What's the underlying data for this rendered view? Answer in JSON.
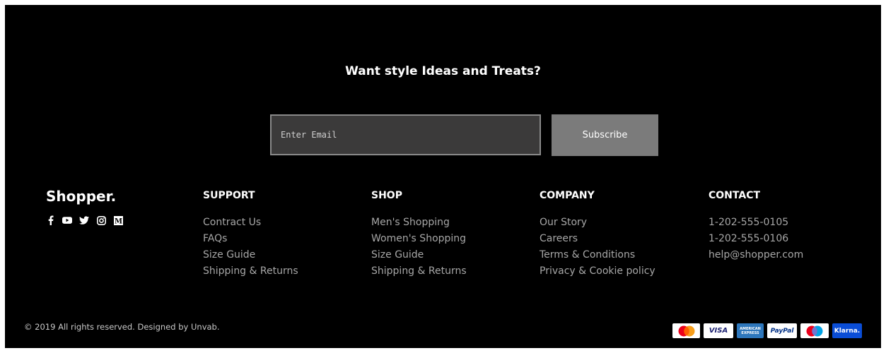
{
  "newsletter": {
    "title": "Want style Ideas and Treats?",
    "email_placeholder": "Enter Email",
    "subscribe_label": "Subscribe"
  },
  "brand": {
    "name": "Shopper.",
    "social_icons": [
      "facebook-icon",
      "youtube-icon",
      "twitter-icon",
      "instagram-icon",
      "medium-icon"
    ]
  },
  "columns": {
    "support": {
      "title": "SUPPORT",
      "links": [
        "Contract Us",
        "FAQs",
        "Size Guide",
        "Shipping & Returns"
      ]
    },
    "shop": {
      "title": "SHOP",
      "links": [
        "Men's Shopping",
        "Women's Shopping",
        "Size Guide",
        "Shipping & Returns"
      ]
    },
    "company": {
      "title": "COMPANY",
      "links": [
        "Our Story",
        "Careers",
        "Terms & Conditions",
        "Privacy & Cookie policy"
      ]
    },
    "contact": {
      "title": "CONTACT",
      "items": [
        "1-202-555-0105",
        "1-202-555-0106",
        "help@shopper.com"
      ]
    }
  },
  "copyright": "© 2019 All rights reserved. Designed by Unvab.",
  "payments": {
    "visa": "VISA",
    "amex_top": "AMERICAN",
    "amex_bottom": "EXPRESS",
    "paypal": "PayPal",
    "klarna": "Klarna."
  },
  "colors": {
    "background": "#000000",
    "input_bg": "#3b3a3a",
    "button_bg": "#7b7b7b",
    "link": "#a7a7a7"
  }
}
